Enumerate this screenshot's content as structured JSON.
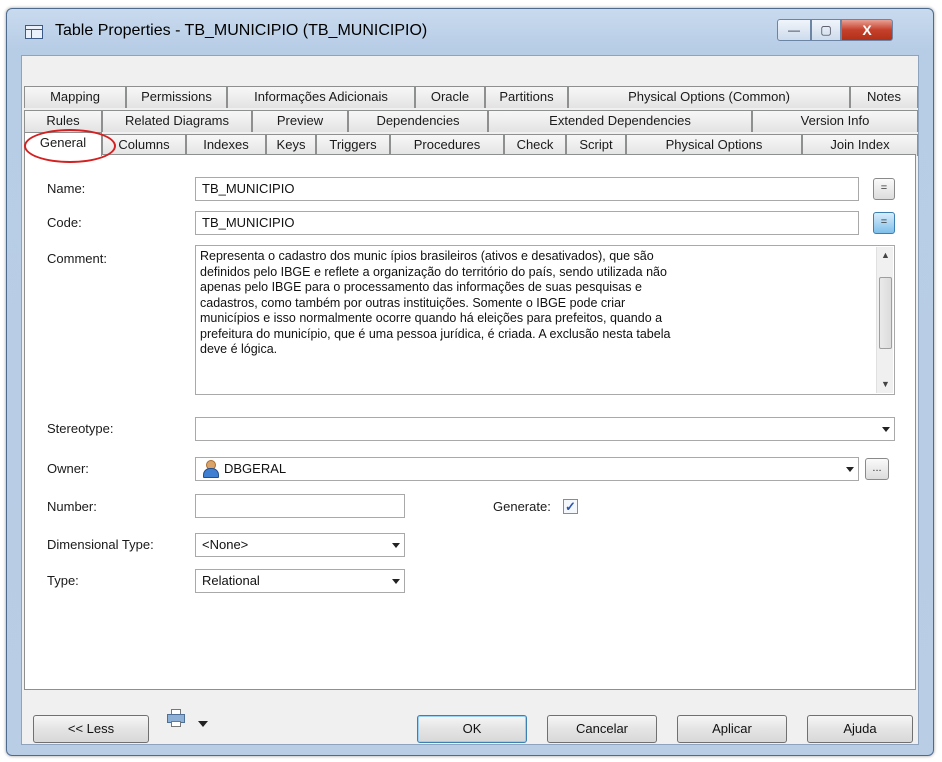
{
  "window": {
    "title": "Table Properties - TB_MUNICIPIO (TB_MUNICIPIO)",
    "min_glyph": "—",
    "max_glyph": "▢",
    "close_glyph": "X"
  },
  "tabs": {
    "row1": [
      "Mapping",
      "Permissions",
      "Informações Adicionais",
      "Oracle",
      "Partitions",
      "Physical Options (Common)",
      "Notes"
    ],
    "row2": [
      "Rules",
      "Related Diagrams",
      "Preview",
      "Dependencies",
      "Extended Dependencies",
      "Version Info"
    ],
    "row3": [
      "General",
      "Columns",
      "Indexes",
      "Keys",
      "Triggers",
      "Procedures",
      "Check",
      "Script",
      "Physical Options",
      "Join Index"
    ],
    "active": "General"
  },
  "form": {
    "name_label": "Name:",
    "name_value": "TB_MUNICIPIO",
    "code_label": "Code:",
    "code_value": "TB_MUNICIPIO",
    "name_btn": "=",
    "code_btn": "=",
    "comment_label": "Comment:",
    "comment_lines": [
      "Representa o cadastro dos  munic ípios brasileiros (ativos e desativados), que são",
      "definidos pelo IBGE e reflete a organização do território do país, sendo utilizada não",
      "apenas pelo IBGE para o processamento das informações de suas pesquisas e",
      "cadastros, como também por outras instituições. Somente o IBGE pode criar",
      "municípios e isso normalmente ocorre quando há eleições para prefeitos, quando a",
      "prefeitura do município, que é uma pessoa jurídica, é criada. A exclusão nesta tabela",
      "deve é lógica."
    ],
    "stereotype_label": "Stereotype:",
    "stereotype_value": "",
    "owner_label": "Owner:",
    "owner_value": "DBGERAL",
    "owner_btn": "...",
    "number_label": "Number:",
    "number_value": "",
    "generate_label": "Generate:",
    "generate_checked": "✓",
    "dimensional_label": "Dimensional Type:",
    "dimensional_value": "<None>",
    "type_label": "Type:",
    "type_value": "Relational"
  },
  "buttons": {
    "less": "<< Less",
    "ok": "OK",
    "cancel": "Cancelar",
    "apply": "Aplicar",
    "help": "Ajuda"
  },
  "colors": {
    "highlight_circle": "#d42020",
    "title_bar": "#b9cde4",
    "close_button": "#c4402a"
  }
}
